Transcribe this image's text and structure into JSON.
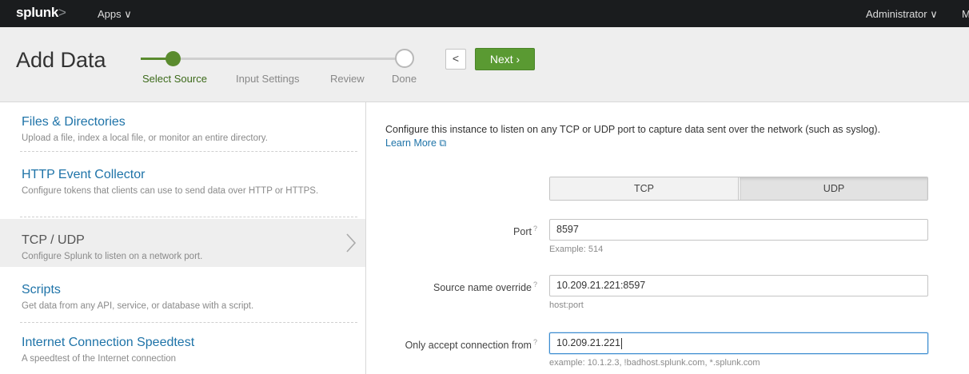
{
  "topbar": {
    "logo_main": "splunk",
    "logo_suffix": ">",
    "apps_label": "Apps ∨",
    "admin_label": "Administrator ∨",
    "messages_label": "M"
  },
  "header": {
    "title": "Add Data",
    "steps": [
      "Select Source",
      "Input Settings",
      "Review",
      "Done"
    ],
    "active_step": "Select Source",
    "back_label": "<",
    "next_label": "Next ›"
  },
  "sidebar": {
    "items": [
      {
        "title": "Files & Directories",
        "desc": "Upload a file, index a local file, or monitor an entire directory."
      },
      {
        "title": "HTTP Event Collector",
        "desc": "Configure tokens that clients can use to send data over HTTP or HTTPS."
      },
      {
        "title": "TCP / UDP",
        "desc": "Configure Splunk to listen on a network port.",
        "active": true
      },
      {
        "title": "Scripts",
        "desc": "Get data from any API, service, or database with a script."
      },
      {
        "title": "Internet Connection Speedtest",
        "desc": "A speedtest of the Internet connection"
      }
    ]
  },
  "main": {
    "intro": "Configure this instance to listen on any TCP or UDP port to capture data sent over the network (such as syslog).",
    "learn_more": "Learn More ⧉",
    "protocol": {
      "options": [
        "TCP",
        "UDP"
      ],
      "selected": "UDP"
    },
    "fields": {
      "port": {
        "label": "Port",
        "value": "8597",
        "hint": "Example: 514"
      },
      "source_name": {
        "label": "Source name override",
        "value": "10.209.21.221:8597",
        "hint": "host:port"
      },
      "accept_from": {
        "label": "Only accept connection from",
        "value": "10.209.21.221",
        "hint": "example: 10.1.2.3, !badhost.splunk.com, *.splunk.com"
      }
    },
    "help_mark": "?"
  },
  "colors": {
    "accent_green": "#5a9a32",
    "link_blue": "#1e73a8",
    "topbar_bg": "#1a1c1e",
    "header_bg": "#eeeeee"
  }
}
